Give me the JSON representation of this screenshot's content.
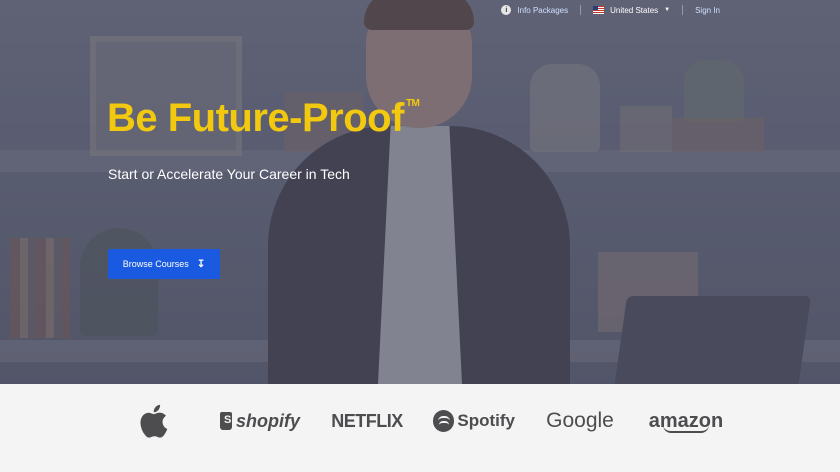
{
  "nav": {
    "info_packages_label": "Info Packages",
    "country_label": "United States",
    "sign_in_label": "Sign In"
  },
  "hero": {
    "title": "Be Future-Proof",
    "trademark": "TM",
    "subtitle": "Start or Accelerate Your Career in Tech",
    "cta_label": "Browse Courses",
    "cta_icon": "↧"
  },
  "logos": {
    "shopify": "shopify",
    "netflix": "NETFLIX",
    "spotify": "Spotify",
    "google": "Google",
    "amazon": "amazon"
  },
  "colors": {
    "accent_yellow": "#f3c90f",
    "button_blue": "#1a5ae0",
    "nav_link": "#cfe0ff",
    "logo_gray": "#4d4d4f"
  }
}
